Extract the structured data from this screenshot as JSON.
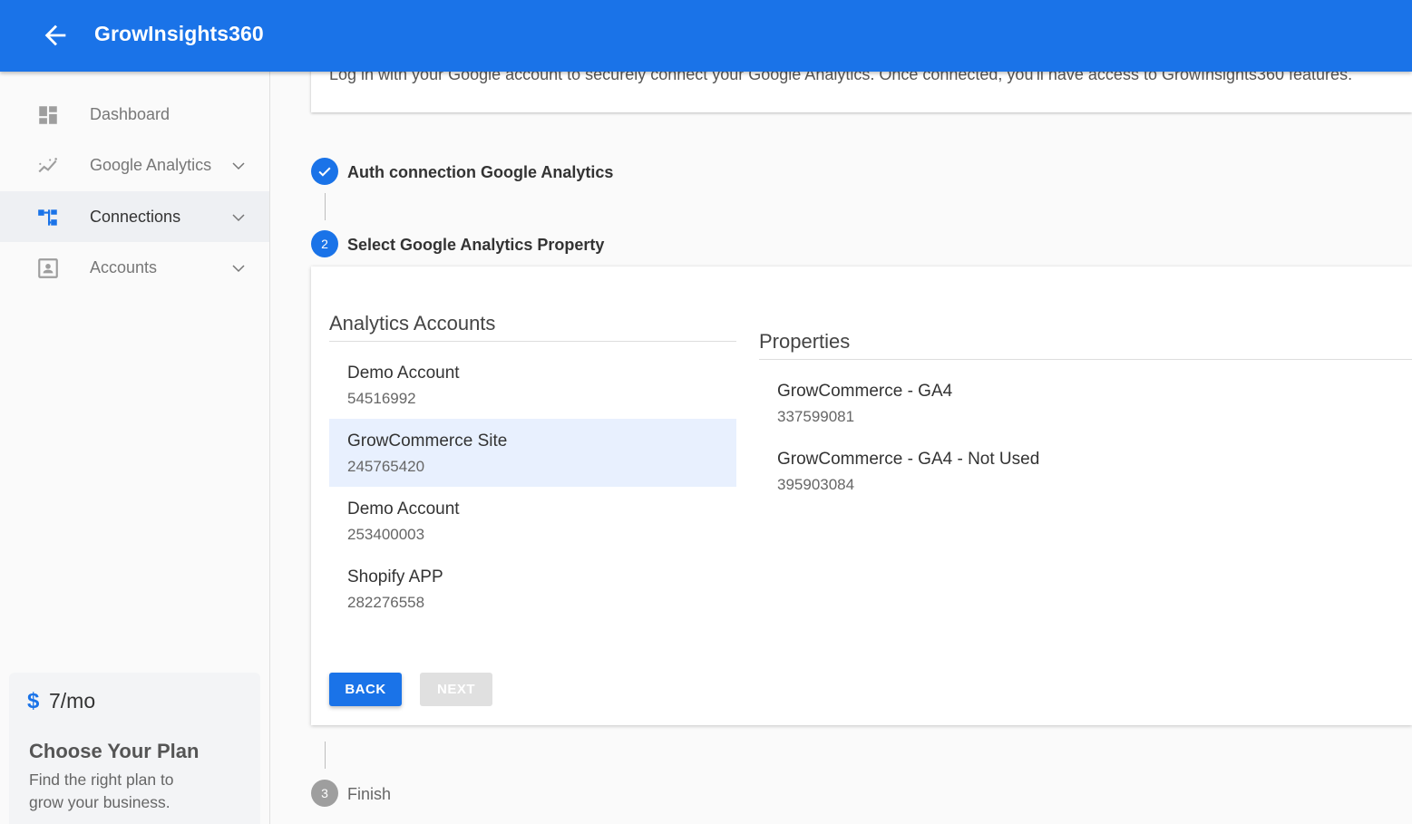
{
  "header": {
    "title": "GrowInsights360",
    "color": "#1a73e8"
  },
  "sidebar": {
    "items": [
      {
        "label": "Dashboard",
        "icon": "dashboard-icon"
      },
      {
        "label": "Google Analytics",
        "icon": "analytics-icon"
      },
      {
        "label": "Connections",
        "icon": "connections-icon",
        "active": true
      },
      {
        "label": "Accounts",
        "icon": "accounts-icon"
      }
    ],
    "plan": {
      "currency_symbol": "$",
      "price": "7/mo",
      "title": "Choose Your Plan",
      "description": "Find the right plan to grow your business."
    }
  },
  "intro": {
    "text": "Log in with your Google account to securely connect your Google Analytics. Once connected, you'll have access to GrowInsights360 features."
  },
  "stepper": {
    "steps": [
      {
        "number": "1",
        "label": "Auth connection Google Analytics",
        "state": "done"
      },
      {
        "number": "2",
        "label": "Select Google Analytics Property",
        "state": "current"
      },
      {
        "number": "3",
        "label": "Finish",
        "state": "pending"
      }
    ]
  },
  "accounts": {
    "title": "Analytics Accounts",
    "items": [
      {
        "name": "Demo Account",
        "id": "54516992"
      },
      {
        "name": "GrowCommerce Site",
        "id": "245765420",
        "selected": true
      },
      {
        "name": "Demo Account",
        "id": "253400003"
      },
      {
        "name": "Shopify APP",
        "id": "282276558"
      }
    ]
  },
  "properties": {
    "title": "Properties",
    "items": [
      {
        "name": "GrowCommerce - GA4",
        "id": "337599081"
      },
      {
        "name": "GrowCommerce - GA4 - Not Used",
        "id": "395903084"
      }
    ]
  },
  "buttons": {
    "back": "BACK",
    "next": "NEXT"
  }
}
